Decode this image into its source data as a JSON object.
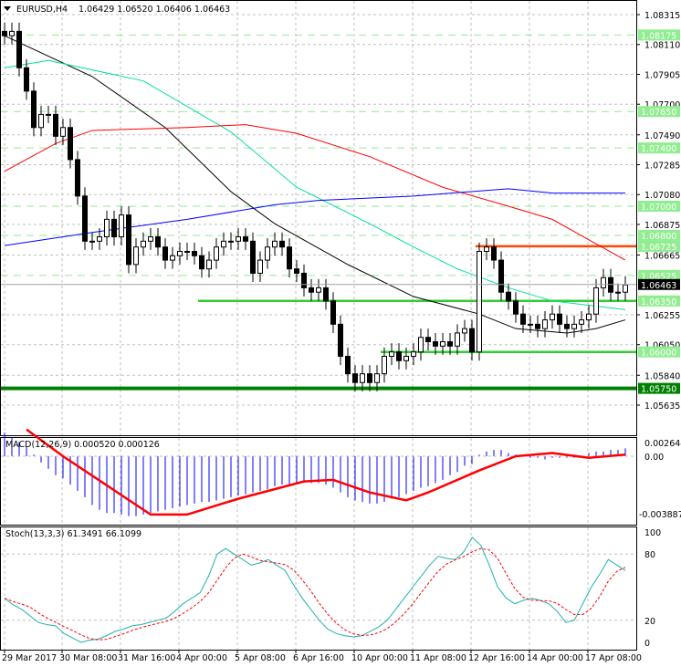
{
  "header": {
    "symbol_tf": "EURUSD,H4",
    "ohlc": "1.06429 1.06520 1.06406 1.06463"
  },
  "price_axis": {
    "ticks": [
      "1.08315",
      "1.08110",
      "1.07905",
      "1.07700",
      "1.07490",
      "1.07285",
      "1.07080",
      "1.06875",
      "1.06665",
      "1.06255",
      "1.06050",
      "1.05840",
      "1.05635"
    ],
    "levels": [
      {
        "label": "1.08175",
        "style": "dashed",
        "color": "#90ee90"
      },
      {
        "label": "1.07650",
        "style": "dashed",
        "color": "#90ee90"
      },
      {
        "label": "1.07400",
        "style": "dashed",
        "color": "#90ee90"
      },
      {
        "label": "1.07000",
        "style": "dashed",
        "color": "#90ee90"
      },
      {
        "label": "1.06800",
        "style": "dashed",
        "color": "#90ee90"
      },
      {
        "label": "1.06525",
        "style": "dashed",
        "color": "#90ee90"
      },
      {
        "label": "1.06725",
        "style": "solid",
        "color": "#ff4500",
        "start": 65,
        "label_bg": "#90ee90"
      },
      {
        "label": "1.06350",
        "style": "solid",
        "color": "#32cd32",
        "start": 27,
        "label_bg": "#90ee90"
      },
      {
        "label": "1.06000",
        "style": "solid",
        "color": "#32cd32",
        "start": 52,
        "label_bg": "#90ee90"
      },
      {
        "label": "1.05750",
        "style": "solid",
        "color": "#008000",
        "start": 0,
        "label_bg": "#008000"
      }
    ],
    "current": "1.06463"
  },
  "chart_data": {
    "type": "candlestick",
    "range": [
      1.05635,
      1.08315
    ],
    "closes": [
      1.0817,
      1.082,
      1.0795,
      1.0779,
      1.0754,
      1.0763,
      1.0763,
      1.0748,
      1.0754,
      1.0732,
      1.0707,
      1.0676,
      1.0676,
      1.0679,
      1.0691,
      1.0679,
      1.0694,
      1.066,
      1.0672,
      1.0676,
      1.0679,
      1.0672,
      1.0663,
      1.0666,
      1.0669,
      1.0669,
      1.0666,
      1.0657,
      1.0663,
      1.0672,
      1.0676,
      1.0676,
      1.0679,
      1.0676,
      1.0654,
      1.0663,
      1.0672,
      1.0676,
      1.0672,
      1.0657,
      1.0654,
      1.0644,
      1.0641,
      1.0644,
      1.0635,
      1.0619,
      1.0597,
      1.0585,
      1.0579,
      1.0585,
      1.0579,
      1.0585,
      1.0597,
      1.06,
      1.0594,
      1.0597,
      1.06,
      1.061,
      1.0607,
      1.0604,
      1.0607,
      1.0604,
      1.0613,
      1.0616,
      1.06,
      1.0669,
      1.0672,
      1.0663,
      1.0641,
      1.0635,
      1.0626,
      1.0619,
      1.0619,
      1.0616,
      1.0622,
      1.0626,
      1.0619,
      1.0616,
      1.0619,
      1.0622,
      1.0626,
      1.0644,
      1.0651,
      1.0641,
      1.0641,
      1.0646
    ],
    "moving_averages": [
      {
        "color": "#000000",
        "points": [
          [
            0,
            1.0817
          ],
          [
            12,
            1.0789
          ],
          [
            22,
            1.0754
          ],
          [
            31,
            1.071
          ],
          [
            37,
            1.0688
          ],
          [
            47,
            1.066
          ],
          [
            56,
            1.0638
          ],
          [
            65,
            1.0626
          ],
          [
            70,
            1.0616
          ],
          [
            77,
            1.0613
          ],
          [
            81,
            1.0616
          ],
          [
            85,
            1.0622
          ]
        ]
      },
      {
        "color": "#00e0a0",
        "points": [
          [
            0,
            1.0795
          ],
          [
            6,
            1.08
          ],
          [
            19,
            1.0786
          ],
          [
            31,
            1.0751
          ],
          [
            40,
            1.0713
          ],
          [
            50,
            1.0688
          ],
          [
            56,
            1.0672
          ],
          [
            62,
            1.0657
          ],
          [
            69,
            1.0644
          ],
          [
            75,
            1.0635
          ],
          [
            85,
            1.0629
          ]
        ]
      },
      {
        "color": "#ff0000",
        "points": [
          [
            0,
            1.0724
          ],
          [
            7,
            1.0743
          ],
          [
            12,
            1.0752
          ],
          [
            25,
            1.0754
          ],
          [
            33,
            1.0756
          ],
          [
            40,
            1.075
          ],
          [
            50,
            1.0734
          ],
          [
            60,
            1.0713
          ],
          [
            69,
            1.07
          ],
          [
            75,
            1.0691
          ],
          [
            85,
            1.0663
          ]
        ]
      },
      {
        "color": "#0000ff",
        "points": [
          [
            0,
            1.0673
          ],
          [
            12,
            1.0682
          ],
          [
            25,
            1.0691
          ],
          [
            37,
            1.0701
          ],
          [
            43,
            1.0704
          ],
          [
            56,
            1.0707
          ],
          [
            69,
            1.0712
          ],
          [
            75,
            1.0709
          ],
          [
            85,
            1.0709
          ]
        ]
      }
    ],
    "x_labels": [
      "29 Mar 2017",
      "30 Mar 08:00",
      "31 Mar 16:00",
      "4 Apr 00:00",
      "5 Apr 08:00",
      "6 Apr 16:00",
      "10 Apr 00:00",
      "11 Apr 08:00",
      "12 Apr 16:00",
      "14 Apr 00:00",
      "17 Apr 08:00"
    ],
    "macd": {
      "title": "MACD(12,26,9) 0.000520 0.000126",
      "axis": [
        "0.002644",
        "0.00",
        "-0.003887"
      ],
      "range": [
        -0.003887,
        0.002644
      ],
      "histogram": [
        0.0015,
        0.0012,
        0.0009,
        0.0006,
        0.0001,
        -0.0004,
        -0.0008,
        -0.0012,
        -0.0014,
        -0.0018,
        -0.0022,
        -0.0026,
        -0.0031,
        -0.0034,
        -0.0036,
        -0.0036,
        -0.0037,
        -0.0038,
        -0.0038,
        -0.0037,
        -0.0036,
        -0.0035,
        -0.0034,
        -0.0033,
        -0.0032,
        -0.0031,
        -0.003,
        -0.0029,
        -0.0029,
        -0.0028,
        -0.0027,
        -0.0026,
        -0.0025,
        -0.0024,
        -0.0023,
        -0.0022,
        -0.0021,
        -0.0019,
        -0.0018,
        -0.0018,
        -0.0017,
        -0.0017,
        -0.0017,
        -0.0017,
        -0.0018,
        -0.002,
        -0.0023,
        -0.0026,
        -0.0028,
        -0.0029,
        -0.003,
        -0.003,
        -0.0029,
        -0.0027,
        -0.0026,
        -0.0024,
        -0.0022,
        -0.002,
        -0.0019,
        -0.0017,
        -0.0015,
        -0.0012,
        -0.001,
        -0.0006,
        -0.0005,
        0.0001,
        0.0003,
        0.0004,
        0.0004,
        0.0002,
        0.0001,
        0.0,
        -0.0001,
        -0.0001,
        -0.0002,
        -0.0001,
        -0.0001,
        -0.0001,
        -0.0001,
        0.0,
        0.0002,
        0.0003,
        0.0003,
        0.0004,
        0.0004,
        0.0005
      ],
      "signal": [
        [
          3,
          0.0017
        ],
        [
          8,
          0.0
        ],
        [
          20,
          -0.0037
        ],
        [
          25,
          -0.0037
        ],
        [
          32,
          -0.0027
        ],
        [
          41,
          -0.0016
        ],
        [
          45,
          -0.0015
        ],
        [
          50,
          -0.0023
        ],
        [
          55,
          -0.0028
        ],
        [
          58,
          -0.0023
        ],
        [
          65,
          -0.0009
        ],
        [
          70,
          0.0
        ],
        [
          75,
          0.0002
        ],
        [
          80,
          -0.0001
        ],
        [
          85,
          0.0001
        ]
      ]
    },
    "stoch": {
      "title": "Stoch(13,3,3) 61.3491 66.1099",
      "axis": [
        "100",
        "80",
        "20",
        "0"
      ],
      "range": [
        0,
        100
      ],
      "main": [
        40,
        34,
        30,
        24,
        18,
        16,
        15,
        8,
        4,
        0,
        2,
        3,
        6,
        10,
        12,
        15,
        16,
        18,
        20,
        22,
        28,
        35,
        40,
        45,
        60,
        80,
        85,
        80,
        75,
        70,
        72,
        75,
        70,
        65,
        52,
        40,
        30,
        20,
        12,
        8,
        6,
        5,
        6,
        10,
        14,
        20,
        30,
        40,
        50,
        60,
        70,
        78,
        76,
        75,
        82,
        95,
        88,
        70,
        50,
        40,
        35,
        38,
        40,
        38,
        35,
        28,
        18,
        20,
        35,
        50,
        62,
        75,
        70,
        65
      ]
    }
  }
}
